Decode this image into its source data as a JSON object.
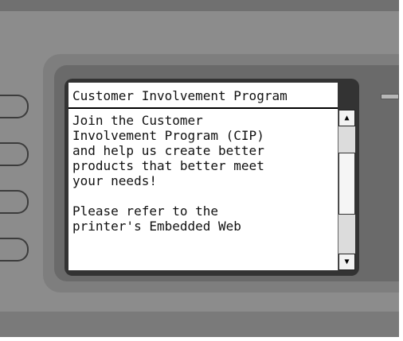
{
  "screen": {
    "title": "Customer Involvement Program",
    "lines": [
      "Join the Customer",
      "Involvement Program (CIP)",
      "and help us create better",
      "products that better meet",
      "your needs!",
      "",
      "Please refer to the",
      "printer's Embedded Web"
    ]
  },
  "scrollbar": {
    "up_icon": "▲",
    "down_icon": "▼"
  },
  "colors": {
    "panel": "#8c8c8c",
    "screen_bg": "#ffffff",
    "text": "#111111"
  }
}
